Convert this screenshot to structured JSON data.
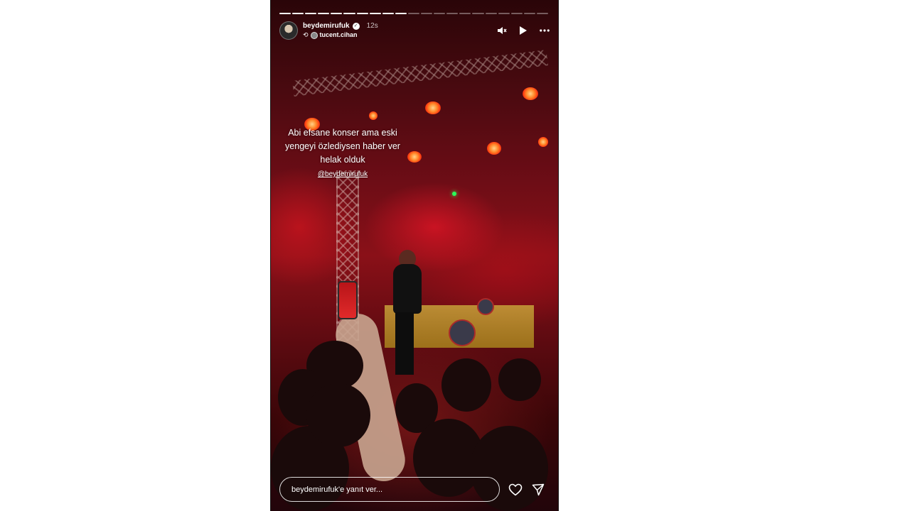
{
  "story": {
    "progress": {
      "segments_total": 21,
      "segments_completed": 10
    },
    "header": {
      "username": "beydemirufuk",
      "verified": true,
      "time": "12s",
      "reposted_from": "tucent.cihan"
    },
    "controls": {
      "mute_icon": "speaker-muted-icon",
      "play_icon": "play-icon",
      "more_icon": "more-horizontal-icon"
    },
    "caption": {
      "lines": [
        "Abi efsane konser ama eski",
        "yengeyi özlediysen haber ver",
        "helak olduk"
      ],
      "mention": "@beydemirufuk"
    },
    "reply": {
      "placeholder": "beydemirufuk'e yanıt ver..."
    },
    "actions": {
      "like_icon": "heart-icon",
      "share_icon": "send-icon"
    }
  }
}
